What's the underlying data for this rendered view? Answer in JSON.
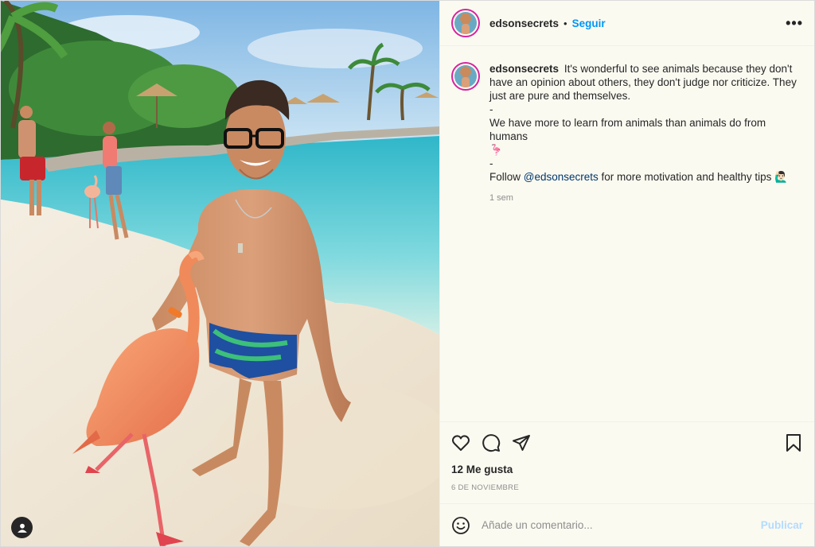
{
  "post": {
    "username": "edsonsecrets",
    "follow_label": "Seguir",
    "dot": "•",
    "more_icon": "more-horizontal-icon",
    "caption": {
      "line1": "It's wonderful to see animals because they don't have an opinion about others, they don't judge nor criticize. They just are pure and themselves.",
      "line2": "-",
      "line3": "We have more to learn from animals than animals do from humans",
      "emoji_flamingo": "🦩",
      "line4": "-",
      "line5_prefix": "Follow ",
      "mention": "@edsonsecrets",
      "line5_suffix": " for more motivation and healthy tips",
      "emoji_person": "🙋🏻‍♂️",
      "time": "1 sem"
    },
    "likes": "12 Me gusta",
    "date": "6 DE NOVIEMBRE",
    "comment_placeholder": "Añade un comentario...",
    "publish_label": "Publicar"
  },
  "colors": {
    "accent": "#0095f6",
    "panel_bg": "#fbfaf1",
    "muted": "#8e8e8e",
    "publish_disabled": "#b3dbff"
  },
  "icons": [
    "heart-icon",
    "comment-icon",
    "share-icon",
    "bookmark-icon",
    "emoji-icon",
    "user-tag-icon"
  ]
}
